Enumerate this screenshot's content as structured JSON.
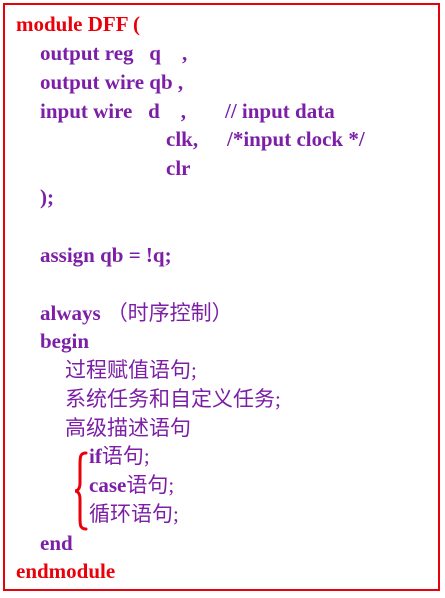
{
  "code": {
    "module_kw": "module",
    "module_name": " DFF (",
    "port_output_reg": "output reg   q    ,",
    "port_output_wire": "output wire qb ,",
    "port_input_head": "input wire   d    ,",
    "port_input_comment1": "// input data",
    "port_clk": "clk,",
    "port_clk_comment": "/*input clock */",
    "port_clr": "clr",
    "ports_close": ");",
    "assign_stmt": "assign qb = !q;",
    "always_kw": "always",
    "always_note": "（时序控制）",
    "begin_kw": "begin",
    "item_procedural": "过程赋值语句;",
    "item_tasks": "系统任务和自定义任务;",
    "item_high_level": "高级描述语句",
    "sub_if_kw": "if",
    "sub_if_cn": "语句;",
    "sub_case_kw": "case",
    "sub_case_cn": "语句;",
    "sub_loop": "循环语句;",
    "end_kw": "end",
    "endmodule_kw": "endmodule"
  },
  "colors": {
    "keyword_red": "#e8000b",
    "code_purple": "#7c1fa6",
    "border_red": "#e8000b"
  }
}
